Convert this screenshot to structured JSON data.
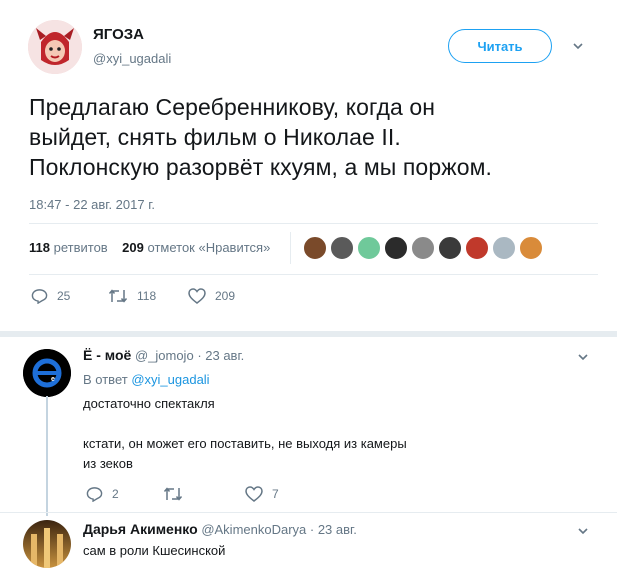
{
  "tweet": {
    "author_name": "ЯГОЗА",
    "author_handle": "@xyi_ugadali",
    "follow_label": "Читать",
    "text_lines": [
      "Предлагаю Серебренникову, когда он",
      "выйдет, снять фильм о Николае II.",
      "Поклонскую разорвёт кхуям, а мы поржом."
    ],
    "timestamp": "18:47 - 22 авг. 2017 г.",
    "retweets_count": "118",
    "retweets_label": "ретвитов",
    "likes_count": "209",
    "likes_label": "отметок «Нравится»",
    "actions": {
      "reply": "25",
      "retweet": "118",
      "like": "209"
    }
  },
  "likers": [
    {
      "icon": "liker-avatar-1",
      "color": "#7a4a2a"
    },
    {
      "icon": "liker-avatar-2",
      "color": "#5a5a5a"
    },
    {
      "icon": "liker-avatar-3",
      "color": "#6fc99a"
    },
    {
      "icon": "liker-avatar-4",
      "color": "#2b2b2b"
    },
    {
      "icon": "liker-avatar-5",
      "color": "#8a8a8a"
    },
    {
      "icon": "liker-avatar-6",
      "color": "#3a3a3a"
    },
    {
      "icon": "liker-avatar-7",
      "color": "#c0392b"
    },
    {
      "icon": "liker-avatar-8",
      "color": "#aab8c2"
    },
    {
      "icon": "liker-avatar-9",
      "color": "#d98b3a"
    }
  ],
  "reply1": {
    "author_name": "Ё - моё",
    "author_handle": "@_jomojo",
    "date": "· 23 авг.",
    "in_reply_prefix": "В ответ",
    "in_reply_handle": "@xyi_ugadali",
    "text_line1": "достаточно спектакля",
    "text_line2": "кстати, он может его поставить, не выходя из камеры",
    "text_line3": "из зеков",
    "actions": {
      "reply": "2",
      "retweet": "",
      "like": "7"
    }
  },
  "reply2": {
    "author_name": "Дарья Акименко",
    "author_handle": "@AkimenkoDarya",
    "date": "· 23 авг.",
    "text_line1": "сам в роли Кшесинской"
  }
}
